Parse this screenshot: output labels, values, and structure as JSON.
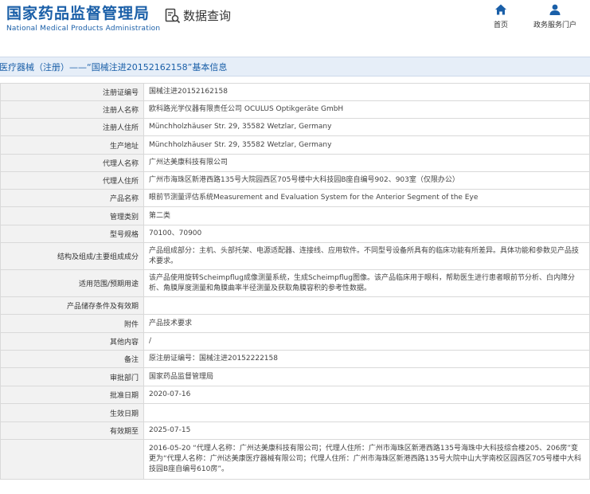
{
  "header": {
    "brand_cn": "国家药品监督管理局",
    "brand_en": "National Medical Products Administration",
    "query_label": "数据查询",
    "nav_home": "首页",
    "nav_portal": "政务服务门户"
  },
  "page_title": "医疗器械（注册）——“国械注进20152162158”基本信息",
  "colors": {
    "brand_blue": "#1a5fa8",
    "label_bg": "#f2f2f2",
    "title_bg": "#e6eef8"
  },
  "rows": [
    {
      "label": "注册证编号",
      "value": "国械注进20152162158"
    },
    {
      "label": "注册人名称",
      "value": "欧科路光学仪器有限责任公司 OCULUS Optikgeräte GmbH"
    },
    {
      "label": "注册人住所",
      "value": "Münchholzhäuser Str. 29, 35582 Wetzlar, Germany"
    },
    {
      "label": "生产地址",
      "value": "Münchholzhäuser Str. 29, 35582 Wetzlar, Germany"
    },
    {
      "label": "代理人名称",
      "value": "广州达美康科技有限公司"
    },
    {
      "label": "代理人住所",
      "value": "广州市海珠区新港西路135号大院园西区705号楼中大科技园B座自编号902、903室（仅限办公）"
    },
    {
      "label": "产品名称",
      "value": "眼前节测量评估系统Measurement and Evaluation System for the Anterior Segment of the Eye"
    },
    {
      "label": "管理类别",
      "value": "第二类"
    },
    {
      "label": "型号规格",
      "value": "70100、70900"
    },
    {
      "label": "结构及组成/主要组成成分",
      "value": "产品组成部分：主机、头部托架、电源适配器、连接线、应用软件。不同型号设备所具有的临床功能有所差异。具体功能和参数见产品技术要求。"
    },
    {
      "label": "适用范围/预期用途",
      "value": "该产品使用旋转Scheimpflug成像测量系统，生成Scheimpflug图像。该产品临床用于眼科，帮助医生进行患者眼前节分析、白内障分析、角膜厚度测量和角膜曲率半径测量及获取角膜容积的参考性数据。"
    },
    {
      "label": "产品储存条件及有效期",
      "value": ""
    },
    {
      "label": "附件",
      "value": "产品技术要求"
    },
    {
      "label": "其他内容",
      "value": "/"
    },
    {
      "label": "备注",
      "value": "原注册证编号：国械注进20152222158"
    },
    {
      "label": "审批部门",
      "value": "国家药品监督管理局"
    },
    {
      "label": "批准日期",
      "value": "2020-07-16"
    },
    {
      "label": "生效日期",
      "value": ""
    },
    {
      "label": "有效期至",
      "value": "2025-07-15"
    },
    {
      "label": "",
      "value": "2016-05-20 “代理人名称：广州达美康科技有限公司；代理人住所：广州市海珠区新港西路135号海珠中大科技综合楼205、206房”变更为“代理人名称：广州达美康医疗器械有限公司；代理人住所：广州市海珠区新港西路135号大院中山大学南校区园西区705号楼中大科技园B座自编号610房”。"
    }
  ]
}
